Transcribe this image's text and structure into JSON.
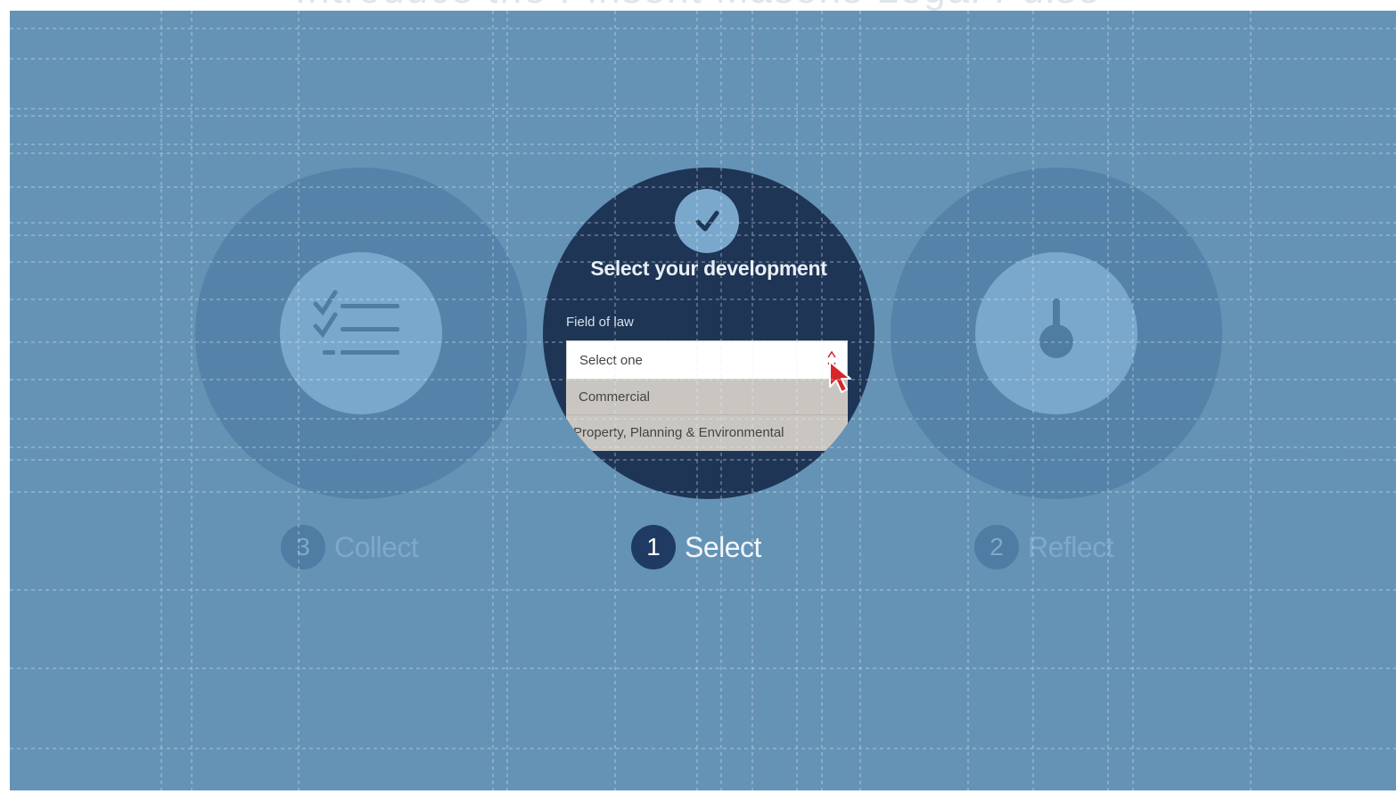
{
  "header": {
    "title": "Introduce the Pinsent Masons Legal Pulse"
  },
  "steps": [
    {
      "number": "3",
      "label": "Collect",
      "state": "inactive",
      "icon": "checklist-icon"
    },
    {
      "number": "1",
      "label": "Select",
      "state": "active",
      "icon": "check-icon"
    },
    {
      "number": "2",
      "label": "Reflect",
      "state": "inactive",
      "icon": "gauge-icon"
    }
  ],
  "panel": {
    "title": "Select your development",
    "field_label": "Field of law",
    "select_value": "Select one",
    "options": [
      "Commercial",
      "Property, Planning & Environmental"
    ]
  },
  "colors": {
    "background": "#6593b6",
    "active_disc": "#1e3556",
    "inactive_disc": "#5582a8",
    "icon_fill": "#7aa8cd",
    "cursor": "#d8262b"
  }
}
